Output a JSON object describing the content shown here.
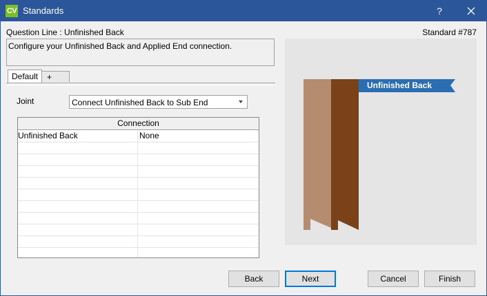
{
  "window": {
    "app_icon_text": "CV",
    "title": "Standards",
    "help_label": "?",
    "close_icon": "close-icon",
    "accent_color": "#2b579a"
  },
  "header": {
    "question_line": "Question Line : Unfinished Back",
    "standard_number": "Standard #787",
    "description": "Configure your Unfinished Back and Applied End connection."
  },
  "tabs": [
    {
      "label": "Default",
      "active": true
    },
    {
      "label": "+",
      "active": false
    }
  ],
  "joint": {
    "label": "Joint",
    "selected": "Connect Unfinished Back to Sub End",
    "arrow_icon": "chevron-down-icon"
  },
  "connection_grid": {
    "header": "Connection",
    "rows": [
      {
        "name": "Unfinished Back",
        "value": "None"
      },
      {
        "name": "",
        "value": ""
      },
      {
        "name": "",
        "value": ""
      },
      {
        "name": "",
        "value": ""
      },
      {
        "name": "",
        "value": ""
      },
      {
        "name": "",
        "value": ""
      },
      {
        "name": "",
        "value": ""
      },
      {
        "name": "",
        "value": ""
      },
      {
        "name": "",
        "value": ""
      },
      {
        "name": "",
        "value": ""
      },
      {
        "name": "",
        "value": ""
      }
    ]
  },
  "preview": {
    "callout_label": "Unfinished Back",
    "callout_color": "#2a6db0",
    "light_panel_color": "#b58c70",
    "dark_panel_color": "#7b4118"
  },
  "buttons": {
    "back": "Back",
    "next": "Next",
    "cancel": "Cancel",
    "finish": "Finish"
  }
}
